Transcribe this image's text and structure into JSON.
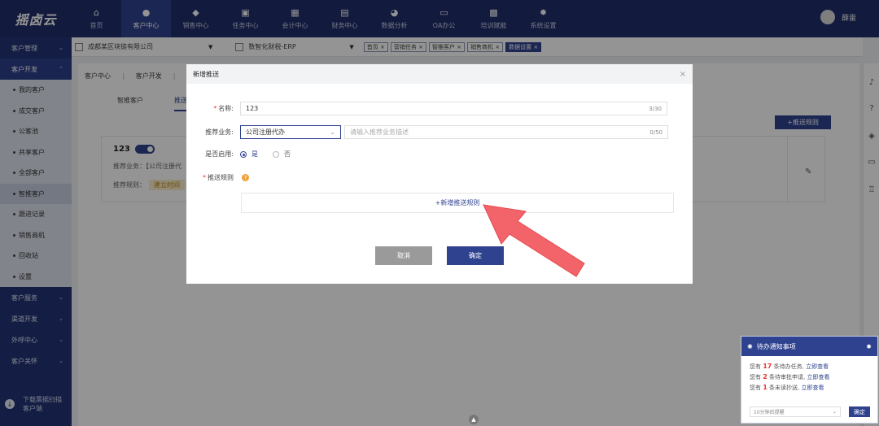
{
  "logo": "摇卤云",
  "nav": [
    {
      "label": "首页",
      "icon": "home-icon"
    },
    {
      "label": "客户中心",
      "icon": "user-icon",
      "active": true
    },
    {
      "label": "销售中心",
      "icon": "tag-icon"
    },
    {
      "label": "任务中心",
      "icon": "calendar-icon"
    },
    {
      "label": "会计中心",
      "icon": "grid-icon"
    },
    {
      "label": "财务中心",
      "icon": "finance-icon"
    },
    {
      "label": "数据分析",
      "icon": "pie-icon"
    },
    {
      "label": "OA办公",
      "icon": "oa-icon"
    },
    {
      "label": "培训赋能",
      "icon": "training-icon"
    },
    {
      "label": "系统设置",
      "icon": "gear-icon"
    }
  ],
  "user": {
    "name": "薛雷"
  },
  "sidebar": {
    "groups_top": [
      {
        "label": "客户管理"
      },
      {
        "label": "客户开发"
      }
    ],
    "items": [
      {
        "label": "我的客户"
      },
      {
        "label": "成交客户"
      },
      {
        "label": "公客池"
      },
      {
        "label": "共享客户"
      },
      {
        "label": "全部客户"
      },
      {
        "label": "智推客户"
      },
      {
        "label": "跟进记录"
      },
      {
        "label": "销售商机"
      },
      {
        "label": "回收站"
      },
      {
        "label": "设置"
      }
    ],
    "groups_bottom": [
      {
        "label": "客户服务"
      },
      {
        "label": "渠道开发"
      },
      {
        "label": "外呼中心"
      },
      {
        "label": "客户关怀"
      }
    ],
    "footer": {
      "line1": "下载票据扫描",
      "line2": "客户端"
    }
  },
  "filterbar": {
    "company": "成都某区块链有限公司",
    "erp": "数智化财税-ERP",
    "chips": [
      "首页",
      "营销任务",
      "智推客户",
      "销售商机",
      "数据设置"
    ]
  },
  "background": {
    "tabs": [
      "客户中心",
      "客户开发"
    ],
    "subtabs": [
      "智推客户",
      "推送"
    ],
    "add_rule": "+推送规则",
    "card": {
      "title": "123",
      "line1": "推荐业务：【公司注册代",
      "line2_label": "推荐规则：",
      "line2_tag": "建立时间"
    }
  },
  "modal": {
    "title": "新增推送",
    "name_label": "名称:",
    "name_value": "123",
    "name_count": "3/30",
    "biz_label": "推荐业务:",
    "biz_value": "公司注册代办",
    "desc_placeholder": "请输入推荐业务描述",
    "desc_count": "0/50",
    "enable_label": "是否启用:",
    "yes": "是",
    "no": "否",
    "rule_label": "推送规则",
    "add_rule_link": "+新增推送规则",
    "cancel": "取消",
    "ok": "确定"
  },
  "notification": {
    "title": "待办通知事项",
    "line1_pre": "您有",
    "line1_num": "17",
    "line1_mid": "条待办任务,",
    "line1_link": "立即查看",
    "line2_pre": "您有",
    "line2_num": "2",
    "line2_mid": "条待审批申请,",
    "line2_link": "立即查看",
    "line3_pre": "您有",
    "line3_num": "1",
    "line3_mid": "条未读抄送,",
    "line3_link": "立即查看",
    "remind_select": "10分钟后提醒",
    "remind_ok": "确定"
  }
}
